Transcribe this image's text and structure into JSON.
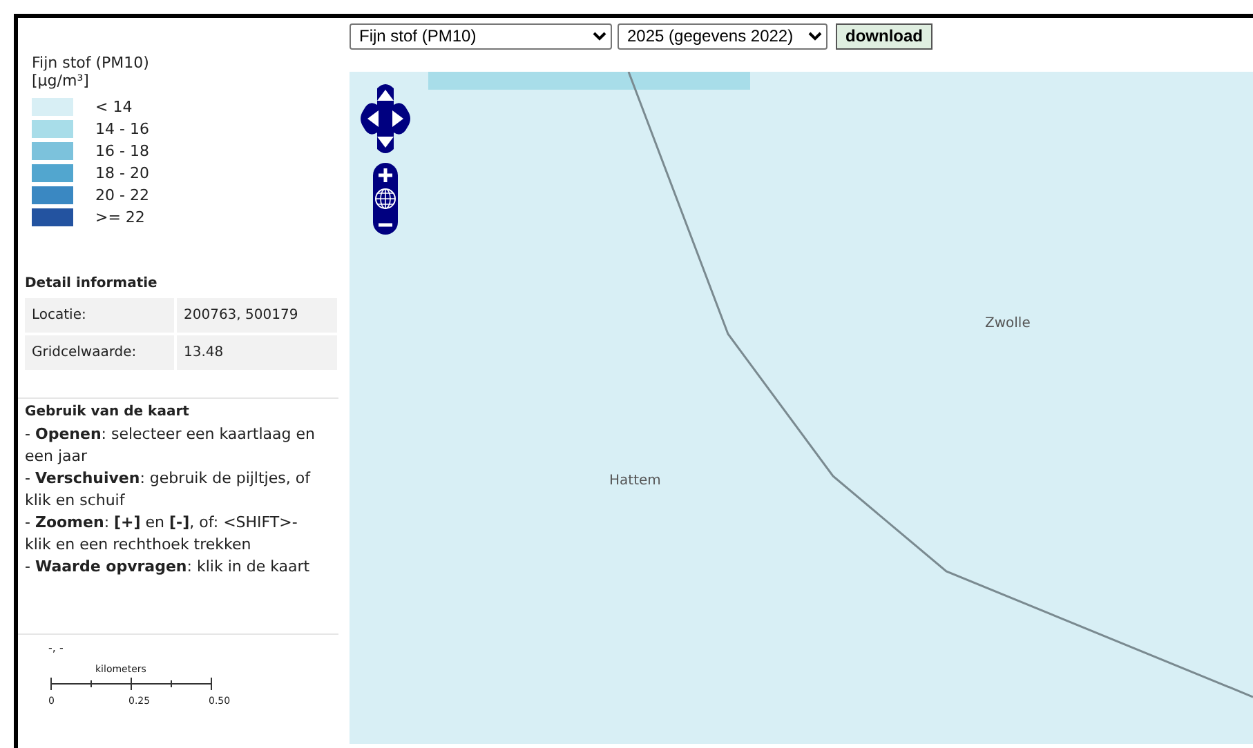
{
  "toolbar": {
    "layer_select": "Fijn stof (PM10)",
    "year_select": "2025 (gegevens 2022)",
    "download_button": "download"
  },
  "legend": {
    "title": "Fijn stof (PM10)",
    "unit": "[µg/m³]",
    "classes": [
      {
        "label": "< 14",
        "color": "#d8eff5"
      },
      {
        "label": "14 - 16",
        "color": "#a8dde9"
      },
      {
        "label": "16 - 18",
        "color": "#7cc2dc"
      },
      {
        "label": "18 - 20",
        "color": "#52a6cf"
      },
      {
        "label": "20 - 22",
        "color": "#3a88c2"
      },
      {
        "label": ">= 22",
        "color": "#2353a0"
      }
    ]
  },
  "detail": {
    "title": "Detail informatie",
    "rows": [
      {
        "label": "Locatie:",
        "value": "200763, 500179"
      },
      {
        "label": "Gridcelwaarde:",
        "value": "13.48"
      }
    ]
  },
  "usage": {
    "title": "Gebruik van de kaart",
    "lines": [
      "- **Openen**: selecteer een kaartlaag en een jaar",
      "- **Verschuiven**: gebruik de pijltjes, of klik en schuif",
      "- **Zoomen**: **[+]** en **[-]**, of: <SHIFT>-klik en een rechthoek trekken",
      "- **Waarde opvragen**: klik in de kaart"
    ]
  },
  "coordinates": "-, -",
  "scale_bar": {
    "unit": "kilometers",
    "ticks": [
      "0",
      "0.25",
      "0.50"
    ]
  },
  "map": {
    "places": [
      "Zwolle",
      "Hattem"
    ]
  }
}
